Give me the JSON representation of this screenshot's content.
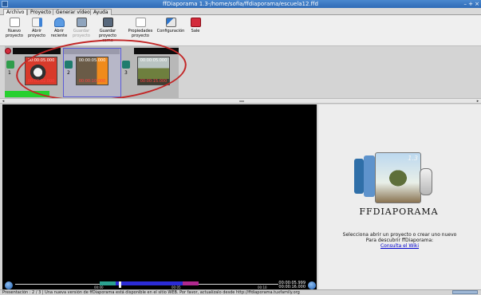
{
  "window": {
    "title": "ffDiaporama 1.3-/home/sofia/ffdiaporama/escuela12.ffd",
    "controls": [
      "–",
      "+",
      "×"
    ]
  },
  "tabs": [
    {
      "label": "Archivo",
      "active": true
    },
    {
      "label": "Proyecto",
      "active": false
    },
    {
      "label": "Generar vídeo",
      "active": false
    },
    {
      "label": "Ayuda",
      "active": false
    }
  ],
  "toolbar": [
    {
      "name": "nuevo-proyecto",
      "icon": "new-doc-icon",
      "lines": [
        "Nuevo",
        "proyecto"
      ],
      "disabled": false
    },
    {
      "name": "abrir-proyecto",
      "icon": "open-folder-icon",
      "lines": [
        "Abrir",
        "proyecto"
      ],
      "disabled": false
    },
    {
      "name": "abrir-reciente",
      "icon": "arrow-down-icon",
      "lines": [
        "Abrir",
        "reciente"
      ],
      "disabled": false
    },
    {
      "name": "guardar-proyecto",
      "icon": "floppy-icon",
      "lines": [
        "Guardar",
        "proyecto"
      ],
      "disabled": true
    },
    {
      "name": "guardar-como",
      "icon": "floppy-as-icon",
      "lines": [
        "Guardar",
        "proyecto como"
      ],
      "disabled": false
    },
    {
      "name": "propiedades",
      "icon": "properties-icon",
      "lines": [
        "Propiedades",
        "proyecto"
      ],
      "disabled": false
    },
    {
      "name": "configuracion",
      "icon": "tools-icon",
      "lines": [
        "Configuración",
        ""
      ],
      "disabled": false
    },
    {
      "name": "sale",
      "icon": "power-icon",
      "lines": [
        "Sale",
        ""
      ],
      "disabled": false
    }
  ],
  "timeline": {
    "slides": [
      {
        "time": "00:00:05.000",
        "number": "1",
        "label_bottom": "00:00:02.000"
      },
      {
        "time": "00:00:05.000",
        "number": "2",
        "label_bottom": "00:00:10.000"
      },
      {
        "time": "00:00:05.000",
        "number": "3",
        "label_bottom": "00:00:15.000"
      }
    ],
    "transition_numbers": [
      "1",
      "2",
      "3"
    ]
  },
  "playback": {
    "ticks": [
      "00:00",
      "00:05",
      "00:10"
    ],
    "current_time": "00:00:05.999",
    "total_time": "00:00:16.000"
  },
  "sidepanel": {
    "badge": "1.3",
    "brand": "FFDIAPORAMA",
    "message_line1": "Selecciona abrir un proyecto o crear uno nuevo",
    "message_line2": "Para descubrir ffDiaporama:",
    "link": "Consulta el Wiki"
  },
  "status": {
    "text": "Presentación : 2 / 3 | Una nueva versión de ffDiaporama está disponible en el sitio WEB. Por favor, actualízalo desde http://ffdiaporama.tuxfamily.org"
  },
  "colors": {
    "titlebar": "#3a7bc8",
    "annotation": "#c22727",
    "selection": "#5b5bd6"
  }
}
